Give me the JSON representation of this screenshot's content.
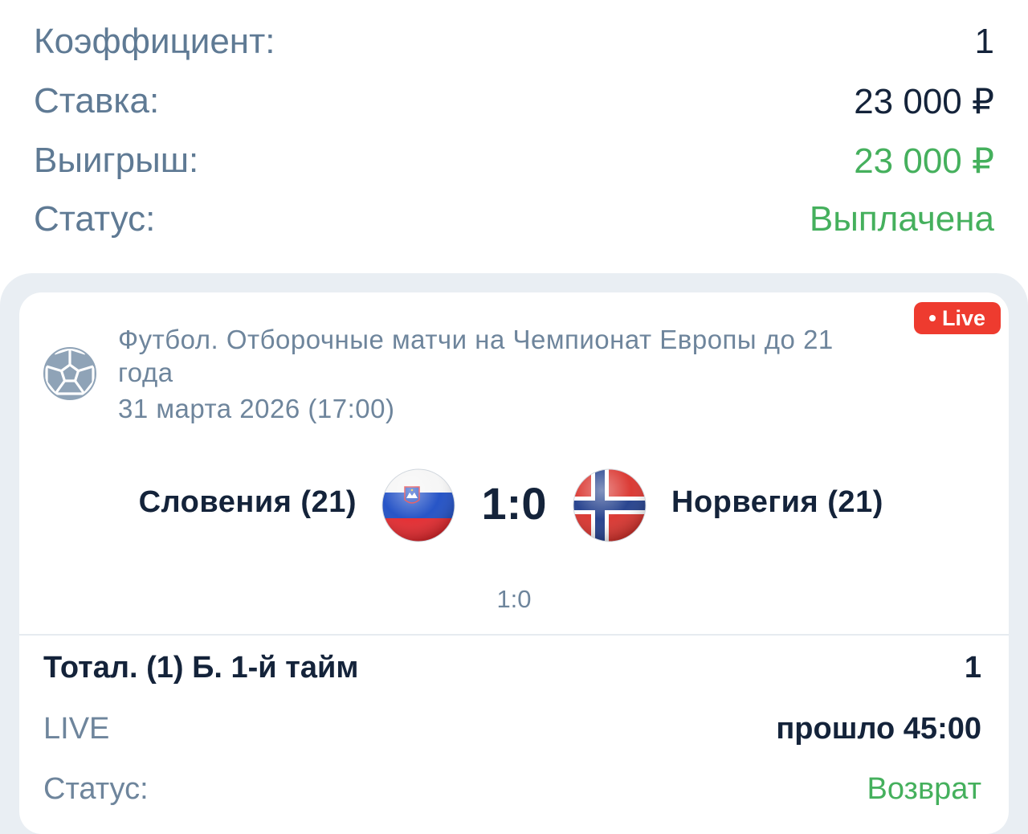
{
  "summary": {
    "coef_label": "Коэффициент:",
    "coef_value": "1",
    "stake_label": "Ставка:",
    "stake_value": "23 000 ₽",
    "win_label": "Выигрыш:",
    "win_value": "23 000 ₽",
    "status_label": "Статус:",
    "status_value": "Выплачена"
  },
  "event": {
    "live_badge": "Live",
    "sport_icon": "soccer-ball-icon",
    "tournament": "Футбол. Отборочные матчи на Чемпионат Европы до 21 года",
    "date": "31 марта 2026 (17:00)",
    "team1": "Словения (21)",
    "team1_flag": "slovenia-flag-icon",
    "team2": "Норвегия (21)",
    "team2_flag": "norway-flag-icon",
    "score": "1:0",
    "subscore": "1:0"
  },
  "bet": {
    "market": "Тотал. (1) Б. 1-й тайм",
    "odds": "1",
    "mode": "LIVE",
    "elapsed": "прошло 45:00",
    "status_label": "Статус:",
    "status_value": "Возврат"
  },
  "colors": {
    "label": "#5f7a94",
    "value": "#14233a",
    "success": "#45b05d",
    "live": "#ee3b2f",
    "card_background": "#e9eef3"
  }
}
